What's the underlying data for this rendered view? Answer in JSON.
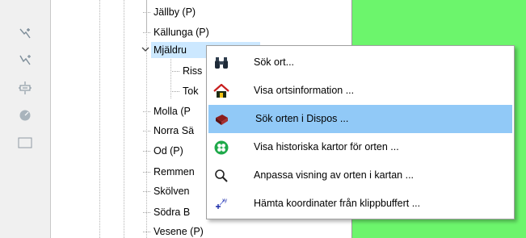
{
  "tree": {
    "nodes": [
      {
        "label": "Jällby (P)"
      },
      {
        "label": "Källunga (P)"
      },
      {
        "label": "Mjäldru"
      },
      {
        "label": "Riss"
      },
      {
        "label": "Tok"
      },
      {
        "label": "Molla (P"
      },
      {
        "label": "Norra Sä"
      },
      {
        "label": "Od (P)"
      },
      {
        "label": "Remmen"
      },
      {
        "label": "Skölven"
      },
      {
        "label": "Södra B"
      },
      {
        "label": "Vesene (P)"
      }
    ]
  },
  "context_menu": {
    "items": [
      {
        "label": "Sök ort...",
        "icon": "binoculars-icon"
      },
      {
        "label": "Visa ortsinformation ...",
        "icon": "house-icon"
      },
      {
        "label": "Sök orten i Dispos ...",
        "icon": "book-icon"
      },
      {
        "label": "Visa historiska kartor för orten ...",
        "icon": "clover-icon"
      },
      {
        "label": "Anpassa visning av orten i kartan ...",
        "icon": "magnifier-icon"
      },
      {
        "label": "Hämta koordinater från klippbuffert ...",
        "icon": "coordinates-icon"
      }
    ]
  },
  "colors": {
    "map_background": "#6cf56c",
    "menu_highlight": "#91c9f7",
    "tree_selection": "#cce8ff"
  }
}
